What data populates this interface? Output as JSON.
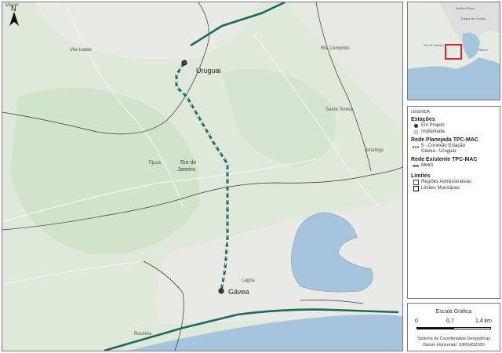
{
  "main_map": {
    "north_label": "N",
    "places": {
      "vila_isabel": "Vila Isabel",
      "meyer": "Meyer",
      "rio_comprido": "Rio Comprido",
      "santa_teresa": "Santa Teresa",
      "botafogo": "Botafogo",
      "tijuca": "Tijuca",
      "rio_de_janeiro_line1": "Rio de",
      "rio_de_janeiro_line2": "Janeiro",
      "lagoa": "Lagoa",
      "rocinha": "Rocinha"
    },
    "stations": {
      "uruguai": "Uruguai",
      "gavea": "Gávea"
    }
  },
  "inset_map": {
    "places": {
      "belford_roxo": "Belford Roxo",
      "duque_de_caxias": "Duque de Caxias",
      "rio_de_janeiro": "Rio de Janeiro",
      "niteroi": "Niterói"
    },
    "highlight_color": "#e0202a"
  },
  "legend": {
    "caption": "LEGENDA",
    "stations_header": "Estações",
    "em_projeto": "Em Projeto",
    "implantada": "Implantada",
    "rede_planejada_header": "Rede Planejada TPC-MAC",
    "conexao_line1": "5 - Conexão Estação",
    "conexao_line2": "Gávea - Uruguai",
    "rede_existente_header": "Rede Existente TPC-MAC",
    "metro": "Metrô",
    "limites_header": "Limites",
    "regioes": "Regiões Administrativas",
    "municipais": "Limites Municipais"
  },
  "scale": {
    "title": "Escala Gráfica",
    "tick_0": "0",
    "tick_mid": "0,7",
    "tick_end": "1,4 km",
    "footer_line1": "Sistema de Coordenadas Geográficas",
    "footer_line2": "Datum Horizontal: SIRGAS2000"
  },
  "colors": {
    "land": "#dfe9da",
    "water": "#a6c4dc",
    "metro_line": "#1a6a60",
    "planned_line": "#1a6a60",
    "urban": "#e9e9e9"
  }
}
